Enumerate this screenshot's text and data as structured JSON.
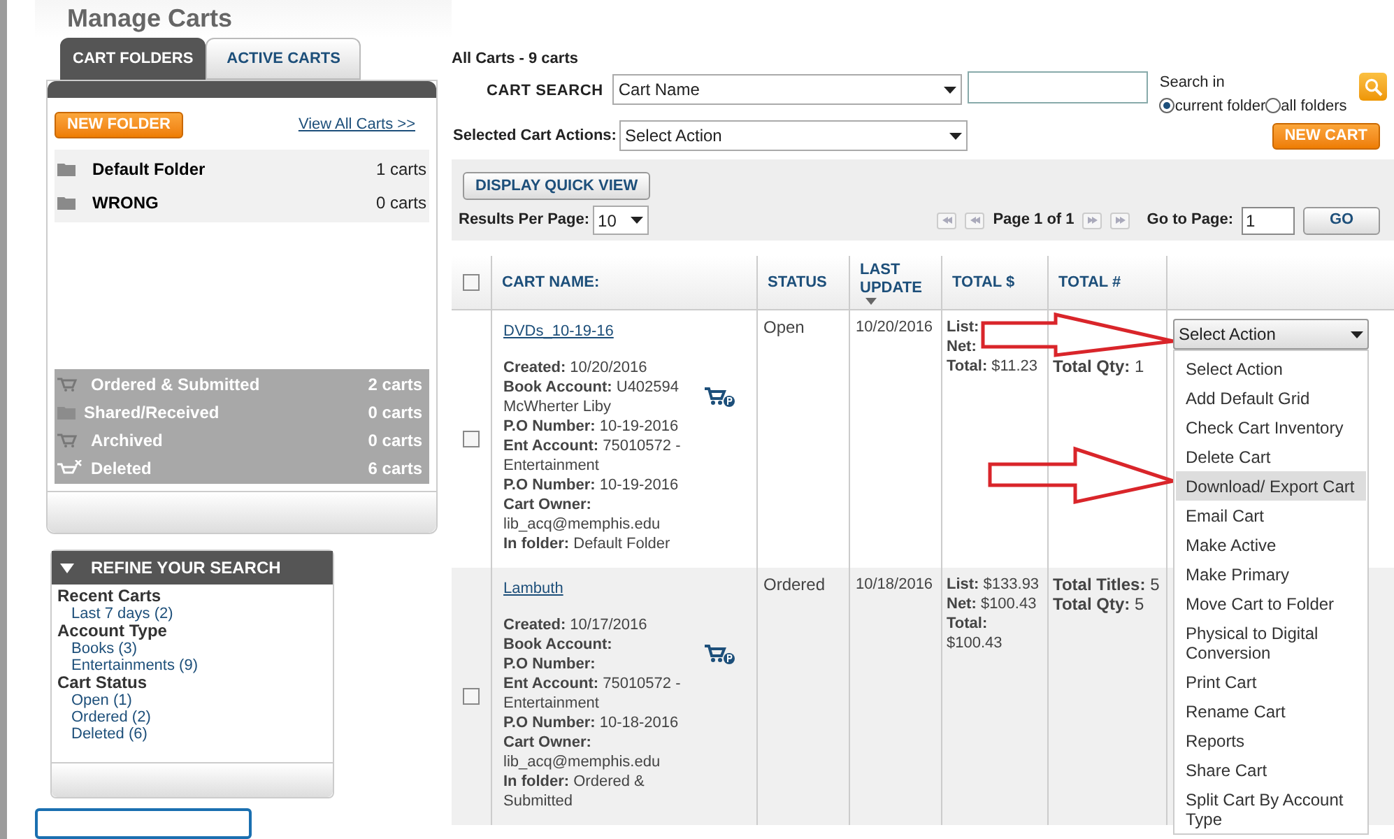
{
  "page_title": "Manage Carts",
  "folder_tabs": [
    {
      "label": "CART FOLDERS",
      "selected": true
    },
    {
      "label": "ACTIVE CARTS",
      "selected": false
    }
  ],
  "new_folder_button": "NEW FOLDER",
  "view_all_link": "View All Carts >>",
  "folders": [
    {
      "name": "Default Folder",
      "count": "1 carts"
    },
    {
      "name": "WRONG",
      "count": "0 carts"
    }
  ],
  "system_folders": [
    {
      "name": "Ordered & Submitted",
      "count": "2 carts",
      "kind": "ordered"
    },
    {
      "name": "Shared/Received",
      "count": "0 carts",
      "kind": "shared"
    },
    {
      "name": "Archived",
      "count": "0 carts",
      "kind": "archived"
    },
    {
      "name": "Deleted",
      "count": "6 carts",
      "kind": "deleted"
    }
  ],
  "refine": {
    "title": "REFINE YOUR SEARCH",
    "groups": [
      {
        "heading": "Recent Carts",
        "links": [
          "Last 7 days (2)"
        ]
      },
      {
        "heading": "Account Type",
        "links": [
          "Books (3)",
          "Entertainments (9)"
        ]
      },
      {
        "heading": "Cart Status",
        "links": [
          "Open (1)",
          "Ordered (2)",
          "Deleted (6)"
        ]
      }
    ]
  },
  "header": {
    "summary": "All Carts - 9 carts",
    "search_label": "CART SEARCH",
    "search_by": "Cart Name",
    "search_in_label": "Search in",
    "scope": [
      {
        "label": "current folder",
        "selected": true
      },
      {
        "label": "all folders",
        "selected": false
      }
    ],
    "actions_label": "Selected Cart Actions:",
    "actions_select": "Select Action",
    "new_cart_button": "NEW CART"
  },
  "toolbar": {
    "quick_view_button": "DISPLAY QUICK VIEW",
    "per_page_label": "Results Per Page:",
    "per_page": "10",
    "page_text": "Page 1 of 1",
    "go_to_label": "Go to Page:",
    "go_to_value": "1",
    "go_button": "GO"
  },
  "table": {
    "columns": [
      "CART NAME:",
      "STATUS",
      "LAST UPDATE",
      "TOTAL $",
      "TOTAL #"
    ],
    "select_all_checked": false,
    "rows": [
      {
        "checked": false,
        "arrows": true,
        "name": "DVDs_10-19-16",
        "details": [
          "**Created:** 10/20/2016",
          "**Book Account:** U402594 McWherter Liby",
          "**P.O Number:** 10-19-2016",
          "**Ent Account:** 75010572 - Entertainment",
          "**P.O Number:** 10-19-2016",
          "**Cart Owner:** lib_acq@memphis.edu",
          "**In folder:** Default Folder"
        ],
        "status": "Open",
        "updated": "10/20/2016",
        "totals": [
          "**List:**",
          "**Net:**",
          "**Total:** $11.23"
        ],
        "counts": [
          "**Total Qty:** 1"
        ]
      },
      {
        "checked": false,
        "name": "Lambuth",
        "details": [
          "**Created:** 10/17/2016",
          "**Book Account:**",
          "**P.O Number:**",
          "**Ent Account:** 75010572 - Entertainment",
          "**P.O Number:** 10-18-2016",
          "**Cart Owner:** lib_acq@memphis.edu",
          "**In folder:** Ordered & Submitted"
        ],
        "status": "Ordered",
        "updated": "10/18/2016",
        "totals": [
          "**List:** $133.93",
          "**Net:** $100.43",
          "**Total:** $100.43"
        ],
        "counts": [
          "**Total Titles:** 5",
          "**Total Qty:** 5"
        ]
      }
    ]
  },
  "action_menu": {
    "value": "Select Action",
    "options": [
      {
        "label": "Select Action",
        "highlighted": false
      },
      {
        "label": "Add Default Grid",
        "highlighted": false
      },
      {
        "label": "Check Cart Inventory",
        "highlighted": false
      },
      {
        "label": "Delete Cart",
        "highlighted": false
      },
      {
        "label": "Download/ Export Cart",
        "highlighted": true
      },
      {
        "label": "Email Cart",
        "highlighted": false
      },
      {
        "label": "Make Active",
        "highlighted": false
      },
      {
        "label": "Make Primary",
        "highlighted": false
      },
      {
        "label": "Move Cart to Folder",
        "highlighted": false
      },
      {
        "label": "Physical to Digital Conversion",
        "highlighted": false
      },
      {
        "label": "Print Cart",
        "highlighted": false
      },
      {
        "label": "Rename Cart",
        "highlighted": false
      },
      {
        "label": "Reports",
        "highlighted": false
      },
      {
        "label": "Share Cart",
        "highlighted": false
      },
      {
        "label": "Split Cart By Account Type",
        "highlighted": false
      }
    ]
  }
}
